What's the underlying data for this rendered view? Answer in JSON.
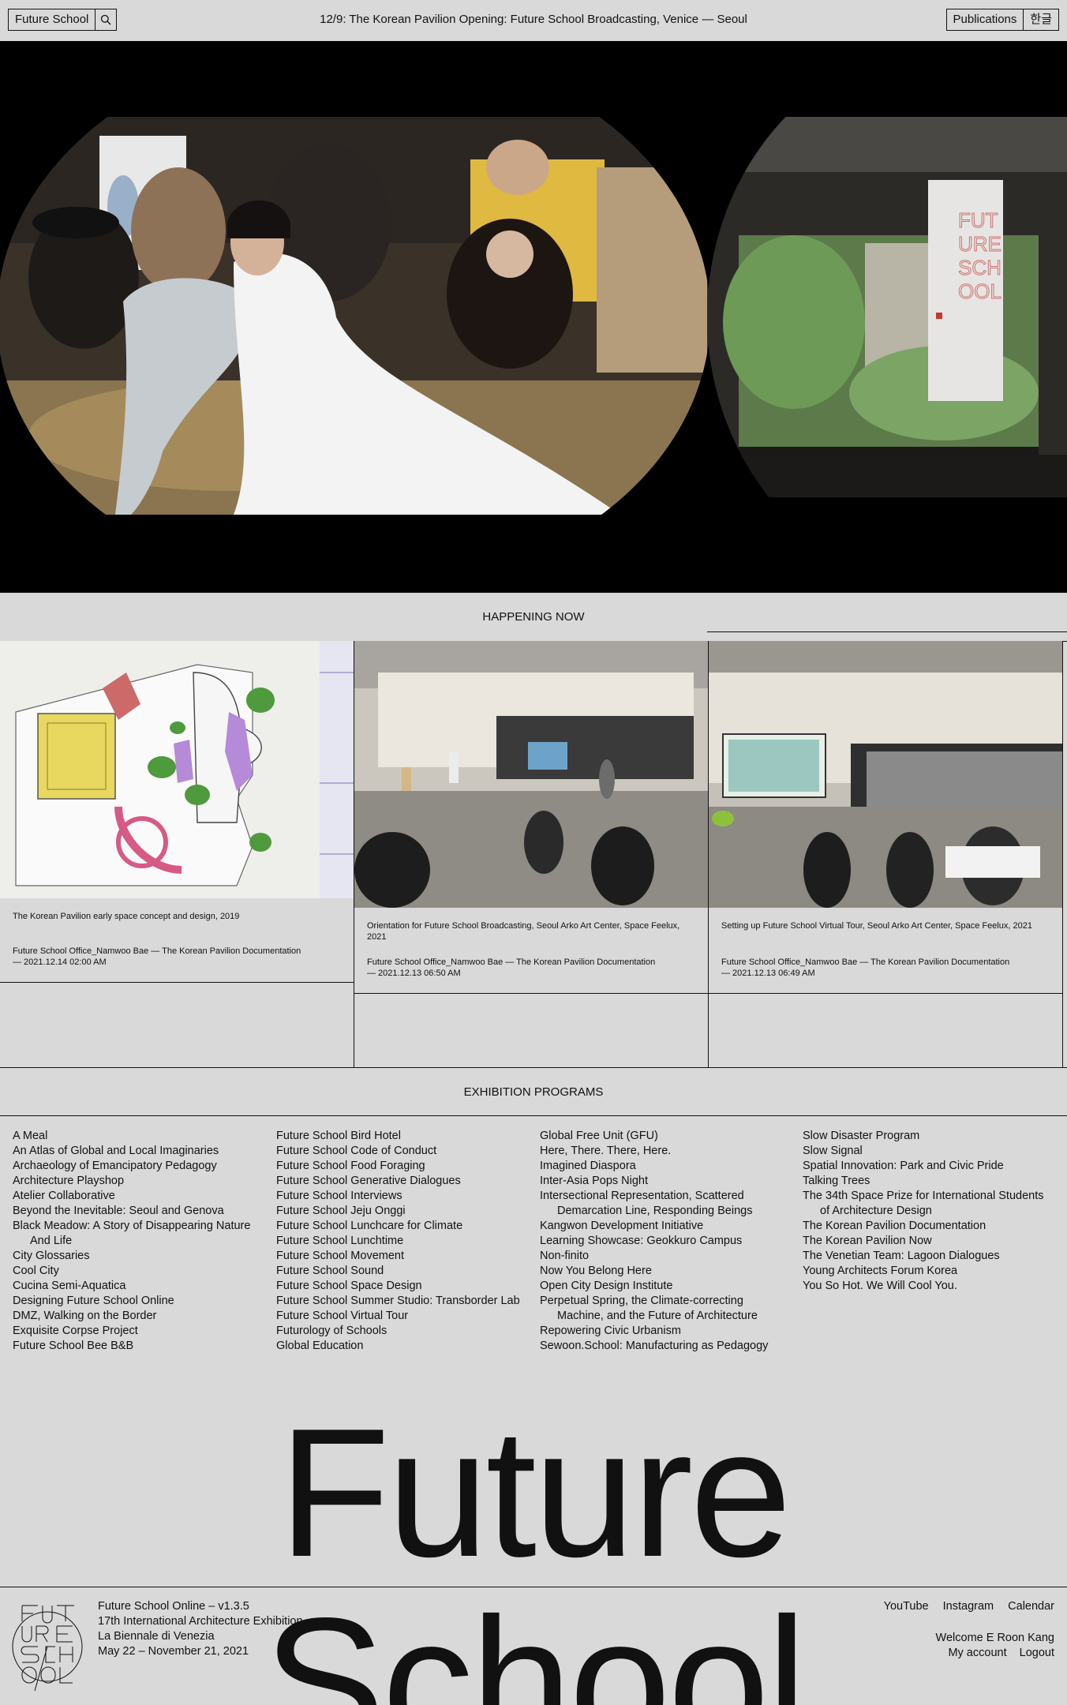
{
  "header": {
    "brand": "Future School",
    "headline": "12/9: The Korean Pavilion Opening: Future School Broadcasting, Venice — Seoul",
    "publications": "Publications",
    "language": "한글"
  },
  "happening": {
    "title": "HAPPENING NOW",
    "cards": [
      {
        "caption": "The Korean Pavilion early space concept and design, 2019",
        "author": "Future School Office_Namwoo Bae — The Korean Pavilion Documentation",
        "date": "— 2021.12.14 02:00 AM"
      },
      {
        "caption": "Orientation for Future School Broadcasting, Seoul Arko Art Center, Space Feelux, 2021",
        "author": "Future School Office_Namwoo Bae — The Korean Pavilion Documentation",
        "date": "— 2021.12.13 06:50 AM"
      },
      {
        "caption": "Setting up Future School Virtual Tour, Seoul Arko Art Center, Space Feelux, 2021",
        "author": "Future School Office_Namwoo Bae — The Korean Pavilion Documentation",
        "date": "— 2021.12.13 06:49 AM"
      }
    ]
  },
  "programs": {
    "title": "EXHIBITION PROGRAMS",
    "col1": [
      {
        "a": "A Meal"
      },
      {
        "a": "An Atlas of Global and Local Imaginaries"
      },
      {
        "a": "Archaeology of Emancipatory Pedagogy"
      },
      {
        "a": "Architecture Playshop"
      },
      {
        "a": "Atelier Collaborative"
      },
      {
        "a": "Beyond the Inevitable: Seoul and Genova"
      },
      {
        "a": "Black Meadow: A Story of Disappearing Nature",
        "b": "And Life"
      },
      {
        "a": "City Glossaries"
      },
      {
        "a": "Cool City"
      },
      {
        "a": "Cucina Semi-Aquatica"
      },
      {
        "a": "Designing Future School Online"
      },
      {
        "a": "DMZ, Walking on the Border"
      },
      {
        "a": "Exquisite Corpse Project"
      },
      {
        "a": "Future School Bee B&B"
      }
    ],
    "col2": [
      {
        "a": "Future School Bird Hotel"
      },
      {
        "a": "Future School Code of Conduct"
      },
      {
        "a": "Future School Food Foraging"
      },
      {
        "a": "Future School Generative Dialogues"
      },
      {
        "a": "Future School Interviews"
      },
      {
        "a": "Future School Jeju Onggi"
      },
      {
        "a": "Future School Lunchcare for Climate"
      },
      {
        "a": "Future School Lunchtime"
      },
      {
        "a": "Future School Movement"
      },
      {
        "a": "Future School Sound"
      },
      {
        "a": "Future School Space Design"
      },
      {
        "a": "Future School Summer Studio: Transborder Lab"
      },
      {
        "a": "Future School Virtual Tour"
      },
      {
        "a": "Futurology of Schools"
      },
      {
        "a": "Global Education"
      }
    ],
    "col3": [
      {
        "a": "Global Free Unit (GFU)"
      },
      {
        "a": "Here, There. There, Here."
      },
      {
        "a": "Imagined Diaspora"
      },
      {
        "a": "Inter-Asia Pops Night"
      },
      {
        "a": "Intersectional Representation, Scattered",
        "b": "Demarcation Line, Responding Beings"
      },
      {
        "a": "Kangwon Development Initiative"
      },
      {
        "a": "Learning Showcase: Geokkuro Campus"
      },
      {
        "a": "Non-finito"
      },
      {
        "a": "Now You Belong Here"
      },
      {
        "a": "Open City Design Institute"
      },
      {
        "a": "Perpetual Spring, the Climate-correcting",
        "b": "Machine, and the Future of Architecture"
      },
      {
        "a": "Repowering Civic Urbanism"
      },
      {
        "a": "Sewoon.School: Manufacturing as Pedagogy"
      }
    ],
    "col4": [
      {
        "a": "Slow Disaster Program"
      },
      {
        "a": "Slow Signal"
      },
      {
        "a": "Spatial Innovation: Park and Civic Pride"
      },
      {
        "a": "Talking Trees"
      },
      {
        "a": "The 34th Space Prize for International Students",
        "b": "of Architecture Design"
      },
      {
        "a": "The Korean Pavilion Documentation"
      },
      {
        "a": "The Korean Pavilion Now"
      },
      {
        "a": "The Venetian Team: Lagoon Dialogues"
      },
      {
        "a": "Young Architects Forum Korea"
      },
      {
        "a": "You So Hot. We Will Cool You."
      }
    ]
  },
  "big_title": "Future School",
  "footer": {
    "version": "Future School Online – v1.3.5",
    "exhibition": "17th International Architecture Exhibition",
    "venue": "La Biennale di Venezia",
    "dates": "May 22 – November 21, 2021",
    "youtube": "YouTube",
    "instagram": "Instagram",
    "calendar": "Calendar",
    "welcome": "Welcome E Roon Kang",
    "my_account": "My account",
    "logout": "Logout"
  },
  "colors": {
    "background": "#d9d9d9",
    "text": "#111111",
    "accent_purple": "#b58ad8",
    "accent_pink": "#d65a86"
  }
}
